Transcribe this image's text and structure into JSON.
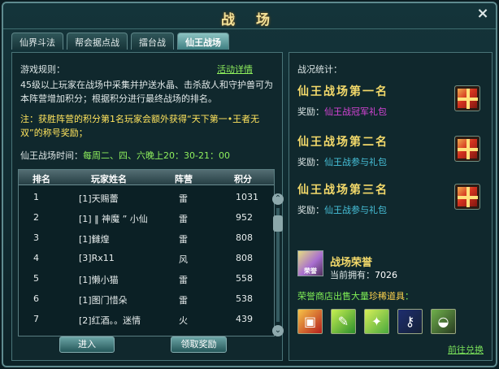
{
  "window": {
    "title": "战 场",
    "close_label": "×"
  },
  "tabs": [
    {
      "label": "仙界斗法"
    },
    {
      "label": "帮会据点战"
    },
    {
      "label": "擂台战"
    },
    {
      "label": "仙王战场"
    }
  ],
  "left": {
    "rules_title": "游戏规则：",
    "event_link": "活动详情",
    "rules_text": "45级以上玩家在战场中采集并护送水晶、击杀敌人和守护兽可为本阵营增加积分；根据积分进行最终战场的排名。",
    "note": "注：获胜阵营的积分第1名玩家会额外获得“天下第一•王者无双”的称号奖励；",
    "time_label": "仙王战场时间：",
    "time_value": "每周二、四、六晚上20：30-21：00",
    "table": {
      "headers": [
        "排名",
        "玩家姓名",
        "阵营",
        "积分"
      ],
      "rows": [
        {
          "rank": "1",
          "name": "[1]天赐蕾",
          "camp": "雷",
          "score": "1031"
        },
        {
          "rank": "2",
          "name": "[1] ‖ 神魔 ” 小仙",
          "camp": "雷",
          "score": "952"
        },
        {
          "rank": "3",
          "name": "[1]雠煌",
          "camp": "雷",
          "score": "808"
        },
        {
          "rank": "4",
          "name": "[3]Rx11",
          "camp": "风",
          "score": "808"
        },
        {
          "rank": "5",
          "name": "[1]懒小猫",
          "camp": "雷",
          "score": "558"
        },
        {
          "rank": "6",
          "name": "[1]图门惜朵",
          "camp": "雷",
          "score": "538"
        },
        {
          "rank": "7",
          "name": "[2]红酒。。迷情",
          "camp": "火",
          "score": "439"
        }
      ]
    },
    "enter_button": "进入",
    "claim_button": "领取奖励"
  },
  "right": {
    "stats_title": "战况统计：",
    "places": [
      {
        "title": "仙王战场第一名",
        "reward_label": "奖励：",
        "reward": "仙王战冠军礼包",
        "reward_color": "#d844d8"
      },
      {
        "title": "仙王战场第二名",
        "reward_label": "奖励：",
        "reward": "仙王战参与礼包",
        "reward_color": "#47c2db"
      },
      {
        "title": "仙王战场第三名",
        "reward_label": "奖励：",
        "reward": "仙王战参与礼包",
        "reward_color": "#47c2db"
      }
    ],
    "honor": {
      "icon_text": "荣誉",
      "title": "战场荣誉",
      "count_label": "当前拥有：",
      "count": "7026"
    },
    "shop": {
      "text_prefix": "荣誉商店出售大量",
      "text_highlight": "珍稀道具",
      "text_suffix": "：",
      "items": [
        "gift-box-icon",
        "green-scroll-icon",
        "lucky-ticket-icon",
        "blue-key-icon",
        "green-lock-icon"
      ]
    },
    "go_link": "前往兑换"
  }
}
